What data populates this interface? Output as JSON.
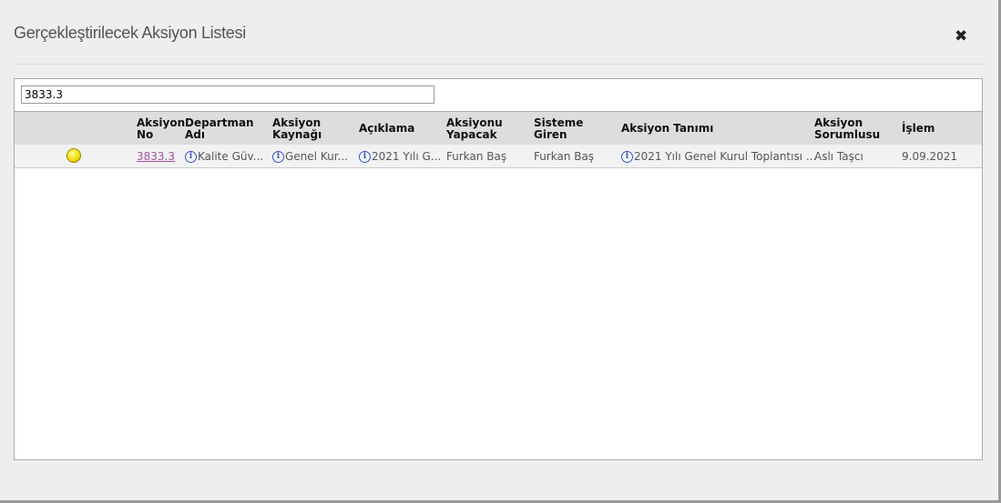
{
  "dialog": {
    "title": "Gerçekleştirilecek Aksiyon Listesi",
    "close_icon": "✖"
  },
  "search": {
    "value": "3833.3"
  },
  "table": {
    "headers": {
      "no": [
        "Aksiyon",
        "No"
      ],
      "dept": [
        "Departman",
        "Adı"
      ],
      "source": [
        "Aksiyon",
        "Kaynağı"
      ],
      "desc": [
        "Açıklama"
      ],
      "doer": [
        "Aksiyonu",
        "Yapacak"
      ],
      "entered": [
        "Sisteme",
        "Giren"
      ],
      "definition": [
        "Aksiyon Tanımı"
      ],
      "owner": [
        "Aksiyon",
        "Sorumlusu"
      ],
      "date": [
        "İşlem"
      ]
    },
    "rows": [
      {
        "status_color": "#eedd00",
        "no": "3833.3",
        "dept": "Kalite Güv...",
        "source": "Genel Kur...",
        "desc": "2021 Yılı G...",
        "doer": "Furkan Baş",
        "entered": "Furkan Baş",
        "definition": "2021 Yılı Genel Kurul Toplantısı ...",
        "owner": "Aslı Taşcı",
        "date": "9.09.2021"
      }
    ]
  }
}
